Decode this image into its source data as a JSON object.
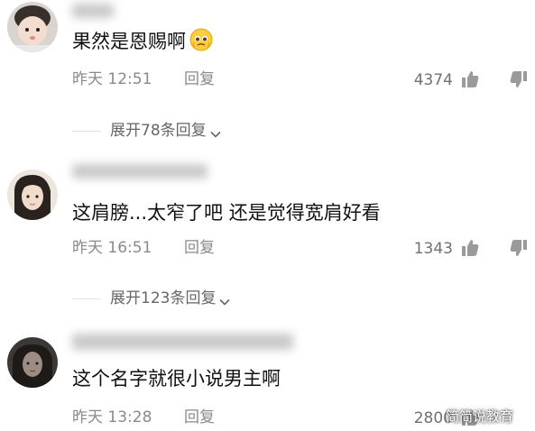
{
  "comments": [
    {
      "text": "果然是恩赐啊",
      "time": "昨天 12:51",
      "reply_label": "回复",
      "like_count": "4374",
      "expand_text": "展开78条回复"
    },
    {
      "text": "这肩膀...太窄了吧 还是觉得宽肩好看",
      "time": "昨天 16:51",
      "reply_label": "回复",
      "like_count": "1343",
      "expand_text": "展开123条回复"
    },
    {
      "text": "这个名字就很小说男主啊",
      "time": "昨天 13:28",
      "reply_label": "回复",
      "like_count": "2800"
    }
  ],
  "watermark": "简简说教育",
  "icons": [
    "avatar",
    "thumbs-up-icon",
    "thumbs-down-icon",
    "chevron-down-icon",
    "pleading-face-emoji-icon"
  ],
  "colors": {
    "text": "#111111",
    "meta": "#8a8a8a",
    "background": "#ffffff"
  }
}
